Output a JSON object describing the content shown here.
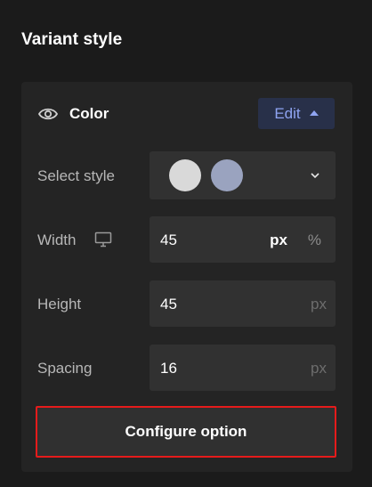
{
  "section": {
    "title": "Variant style"
  },
  "color_row": {
    "label": "Color",
    "edit_label": "Edit"
  },
  "select_style": {
    "label": "Select style",
    "swatches": [
      "#d9d9d9",
      "#9aa3bf"
    ]
  },
  "width": {
    "label": "Width",
    "value": "45",
    "unit_active": "px",
    "unit_alt": "%"
  },
  "height": {
    "label": "Height",
    "value": "45",
    "unit": "px"
  },
  "spacing": {
    "label": "Spacing",
    "value": "16",
    "unit": "px"
  },
  "configure_button": {
    "label": "Configure option"
  },
  "colors": {
    "background": "#1b1b1b",
    "panel": "#242424",
    "field": "#313131",
    "accent": "#8fa4f2",
    "highlight_border": "#e51b1b"
  }
}
